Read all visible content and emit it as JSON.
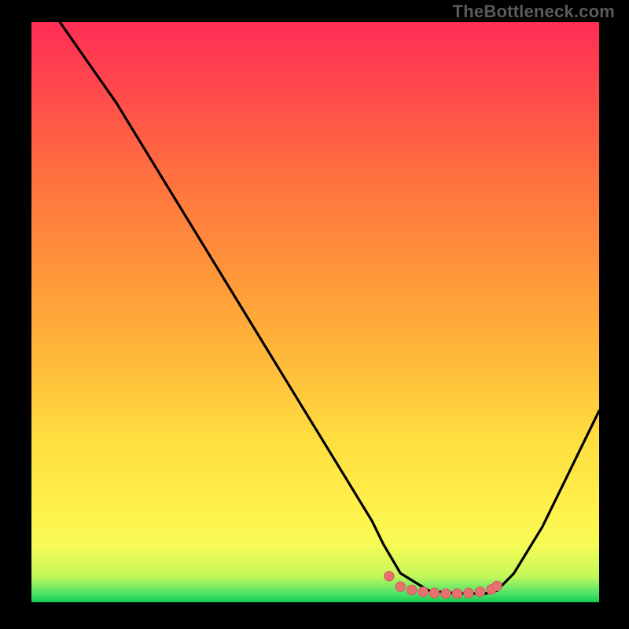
{
  "watermark": "TheBottleneck.com",
  "colors": {
    "background": "#000000",
    "curve": "#000000",
    "marker_fill": "#e77171",
    "marker_stroke": "#d85a5a",
    "gradient_stops": [
      {
        "offset": 0.0,
        "color": "#ff2d55"
      },
      {
        "offset": 0.12,
        "color": "#ff4a4c"
      },
      {
        "offset": 0.26,
        "color": "#ff6f3f"
      },
      {
        "offset": 0.42,
        "color": "#ff933a"
      },
      {
        "offset": 0.58,
        "color": "#ffb93a"
      },
      {
        "offset": 0.72,
        "color": "#ffde40"
      },
      {
        "offset": 0.83,
        "color": "#ffef4a"
      },
      {
        "offset": 0.9,
        "color": "#f8fb55"
      },
      {
        "offset": 0.955,
        "color": "#c4f85a"
      },
      {
        "offset": 0.985,
        "color": "#4de36a"
      },
      {
        "offset": 1.0,
        "color": "#17c94f"
      }
    ]
  },
  "chart_data": {
    "type": "line",
    "title": "",
    "xlabel": "",
    "ylabel": "",
    "xlim": [
      0,
      100
    ],
    "ylim": [
      0,
      100
    ],
    "grid": false,
    "legend": false,
    "series": [
      {
        "name": "bottleneck-curve",
        "x": [
          5,
          10,
          15,
          20,
          25,
          30,
          35,
          40,
          45,
          50,
          55,
          60,
          62,
          65,
          70,
          75,
          80,
          82,
          85,
          90,
          95,
          100
        ],
        "values": [
          100,
          93,
          86,
          78,
          70,
          62,
          54,
          46,
          38,
          30,
          22,
          14,
          10,
          5,
          2,
          1.5,
          1.5,
          2,
          5,
          13,
          23,
          33
        ]
      }
    ],
    "markers": {
      "name": "highlight-range",
      "x": [
        63,
        65,
        67,
        69,
        71,
        73,
        75,
        77,
        79,
        81,
        82
      ],
      "values": [
        4.5,
        2.7,
        2.1,
        1.8,
        1.6,
        1.5,
        1.5,
        1.6,
        1.8,
        2.2,
        2.8
      ]
    }
  }
}
